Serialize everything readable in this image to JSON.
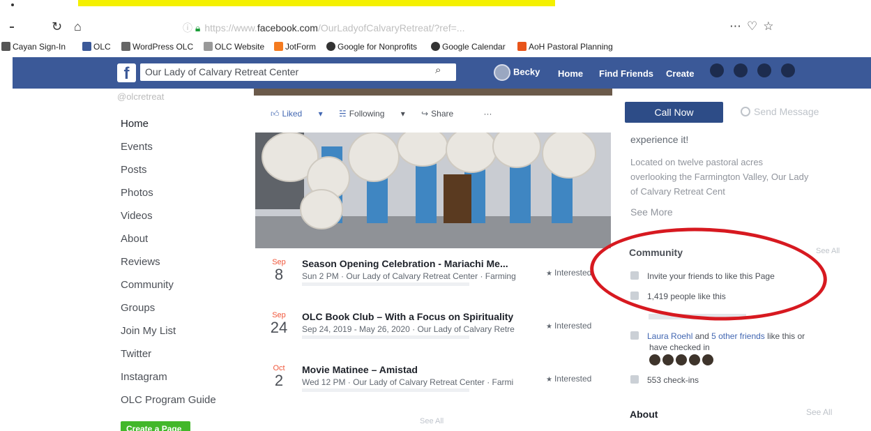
{
  "browser": {
    "url_domain": "facebook.com",
    "url_faint_before": "https://www.",
    "url_faint_after": "/OurLadyofCalvaryRetreat/?ref=...",
    "bookmarks": [
      {
        "label": "Cayan Sign-In",
        "color": "#555555"
      },
      {
        "label": "OLC",
        "color": "#3b5998"
      },
      {
        "label": "WordPress OLC",
        "color": "#666666"
      },
      {
        "label": "OLC Website",
        "color": "#999999"
      },
      {
        "label": "JotForm",
        "color": "#f47b20"
      },
      {
        "label": "Google for Nonprofits",
        "color": "#333333"
      },
      {
        "label": "Google Calendar",
        "color": "#333333"
      },
      {
        "label": "AoH Pastoral Planning",
        "color": "#e8541a"
      }
    ]
  },
  "fbbar": {
    "logo": "f",
    "search_value": "Our Lady of Calvary Retreat Center",
    "profile_name": "Becky",
    "home": "Home",
    "find_friends": "Find Friends",
    "create": "Create"
  },
  "sidebar": {
    "handle": "@olcretreat",
    "items": [
      "Home",
      "Events",
      "Posts",
      "Photos",
      "Videos",
      "About",
      "Reviews",
      "Community",
      "Groups",
      "Join My List",
      "Twitter",
      "Instagram",
      "OLC Program Guide"
    ],
    "create_page": "Create a Page"
  },
  "actions": {
    "liked": "Liked",
    "following": "Following",
    "share": "Share",
    "more": "···"
  },
  "events": [
    {
      "month": "Sep",
      "day": "8",
      "title": "Season Opening Celebration - Mariachi Me...",
      "sub": "Sun 2 PM · Our Lady of Calvary Retreat Center · Farming",
      "interest": "Interested"
    },
    {
      "month": "Sep",
      "day": "24",
      "title": "OLC Book Club – With a Focus on Spirituality",
      "sub": "Sep 24, 2019 - May 26, 2020 · Our Lady of Calvary Retre",
      "interest": "Interested"
    },
    {
      "month": "Oct",
      "day": "2",
      "title": "Movie Matinee – Amistad",
      "sub": "Wed 12 PM · Our Lady of Calvary Retreat Center · Farmi",
      "interest": "Interested"
    }
  ],
  "events_see_all": "See All",
  "right": {
    "call_now": "Call Now",
    "send_message": "Send Message",
    "experience": "experience it!",
    "about_text": "Located on twelve pastoral acres overlooking the Farmington Valley, Our Lady of Calvary Retreat Cent",
    "see_more": "See More",
    "community_title": "Community",
    "community_see_all": "See All",
    "invite": "Invite your friends to like this Page",
    "likes": "1,419 people like this",
    "friend_name": "Laura Roehl",
    "friends_and": " and ",
    "other_friends": "5 other friends",
    "friends_suffix": " like this or",
    "friends_line2": "have checked in",
    "checkins": "553 check-ins",
    "about_title": "About",
    "about_see_all": "See All"
  },
  "colors": {
    "fb_blue": "#3b5998",
    "call_now": "#2d4c87",
    "annotation_red": "#d71920"
  }
}
